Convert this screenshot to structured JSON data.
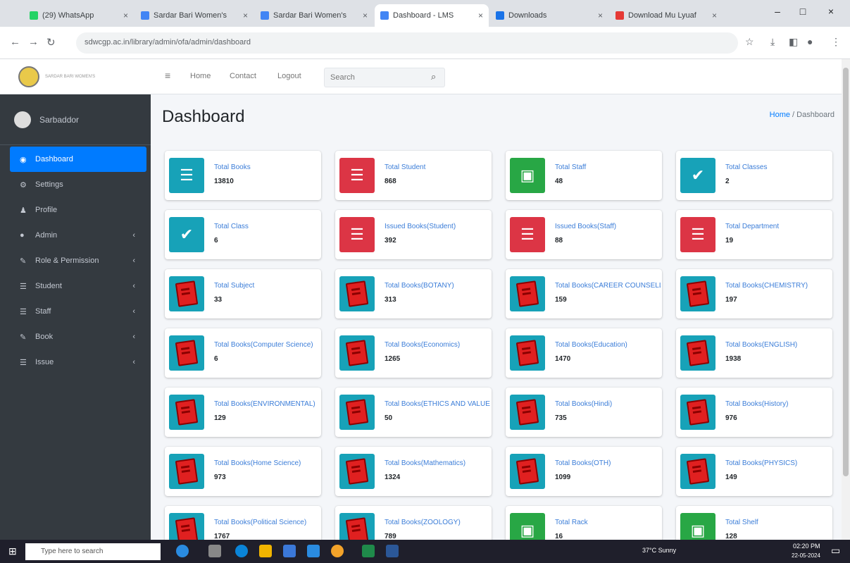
{
  "browser": {
    "tabs": [
      {
        "label": "(29) WhatsApp",
        "color": "#25d366"
      },
      {
        "label": "Sardar Bari Women's",
        "color": "#4285f4"
      },
      {
        "label": "Sardar Bari Women's",
        "color": "#4285f4"
      },
      {
        "label": "Dashboard - LMS",
        "color": "#4285f4"
      },
      {
        "label": "Downloads",
        "color": "#1a73e8"
      },
      {
        "label": "Download Mu Lyuaf",
        "color": "#e53935"
      }
    ],
    "url": "sdwcgp.ac.in/library/admin/ofa/admin/dashboard"
  },
  "brand": {
    "text": "SARDAR BARI WOMEN'S"
  },
  "user": {
    "name": "Sarbaddor"
  },
  "sidebar": {
    "items": [
      {
        "label": "Dashboard",
        "icon": "◉"
      },
      {
        "label": "Settings",
        "icon": "⚙"
      },
      {
        "label": "Profile",
        "icon": "♟"
      },
      {
        "label": "Admin",
        "icon": "●",
        "chev": "‹"
      },
      {
        "label": "Role & Permission",
        "icon": "✎",
        "chev": "‹"
      },
      {
        "label": "Student",
        "icon": "☰",
        "chev": "‹"
      },
      {
        "label": "Staff",
        "icon": "☰",
        "chev": "‹"
      },
      {
        "label": "Book",
        "icon": "✎",
        "chev": "‹"
      },
      {
        "label": "Issue",
        "icon": "☰",
        "chev": "‹"
      }
    ]
  },
  "topnav": {
    "menu": "≡",
    "home": "Home",
    "contact": "Contact",
    "logout": "Logout",
    "search_placeholder": "Search",
    "search_icon": "⌕"
  },
  "page": {
    "title": "Dashboard",
    "breadcrumb_home": "Home",
    "breadcrumb_sep": " / ",
    "breadcrumb_current": "Dashboard"
  },
  "cards": [
    {
      "label": "Total Books",
      "value": "13810",
      "color": "teal",
      "icon": "users"
    },
    {
      "label": "Total Student",
      "value": "868",
      "color": "red",
      "icon": "users"
    },
    {
      "label": "Total Staff",
      "value": "48",
      "color": "green",
      "icon": "money"
    },
    {
      "label": "Total Classes",
      "value": "2",
      "color": "teal",
      "icon": "key"
    },
    {
      "label": "Total Class",
      "value": "6",
      "color": "teal",
      "icon": "key"
    },
    {
      "label": "Issued Books(Student)",
      "value": "392",
      "color": "red",
      "icon": "users"
    },
    {
      "label": "Issued Books(Staff)",
      "value": "88",
      "color": "red",
      "icon": "users"
    },
    {
      "label": "Total Department",
      "value": "19",
      "color": "red",
      "icon": "users"
    },
    {
      "label": "Total Subject",
      "value": "33",
      "color": "teal",
      "icon": "book"
    },
    {
      "label": "Total Books(BOTANY)",
      "value": "313",
      "color": "teal",
      "icon": "book"
    },
    {
      "label": "Total Books(CAREER COUNSELLING)",
      "value": "159",
      "color": "teal",
      "icon": "book"
    },
    {
      "label": "Total Books(CHEMISTRY)",
      "value": "197",
      "color": "teal",
      "icon": "book"
    },
    {
      "label": "Total Books(Computer Science)",
      "value": "6",
      "color": "teal",
      "icon": "book"
    },
    {
      "label": "Total Books(Economics)",
      "value": "1265",
      "color": "teal",
      "icon": "book"
    },
    {
      "label": "Total Books(Education)",
      "value": "1470",
      "color": "teal",
      "icon": "book"
    },
    {
      "label": "Total Books(ENGLISH)",
      "value": "1938",
      "color": "teal",
      "icon": "book"
    },
    {
      "label": "Total Books(ENVIRONMENTAL)",
      "value": "129",
      "color": "teal",
      "icon": "book"
    },
    {
      "label": "Total Books(ETHICS AND VALUES)",
      "value": "50",
      "color": "teal",
      "icon": "book"
    },
    {
      "label": "Total Books(Hindi)",
      "value": "735",
      "color": "teal",
      "icon": "book"
    },
    {
      "label": "Total Books(History)",
      "value": "976",
      "color": "teal",
      "icon": "book"
    },
    {
      "label": "Total Books(Home Science)",
      "value": "973",
      "color": "teal",
      "icon": "book"
    },
    {
      "label": "Total Books(Mathematics)",
      "value": "1324",
      "color": "teal",
      "icon": "book"
    },
    {
      "label": "Total Books(OTH)",
      "value": "1099",
      "color": "teal",
      "icon": "book"
    },
    {
      "label": "Total Books(PHYSICS)",
      "value": "149",
      "color": "teal",
      "icon": "book"
    },
    {
      "label": "Total Books(Political Science)",
      "value": "1767",
      "color": "teal",
      "icon": "book"
    },
    {
      "label": "Total Books(ZOOLOGY)",
      "value": "789",
      "color": "teal",
      "icon": "book"
    },
    {
      "label": "Total Rack",
      "value": "16",
      "color": "green",
      "icon": "money"
    },
    {
      "label": "Total Shelf",
      "value": "128",
      "color": "green",
      "icon": "money"
    }
  ],
  "taskbar": {
    "search_placeholder": "Type here to search",
    "weather": "37°C Sunny",
    "time": "02:20 PM",
    "date": "22-05-2024"
  }
}
